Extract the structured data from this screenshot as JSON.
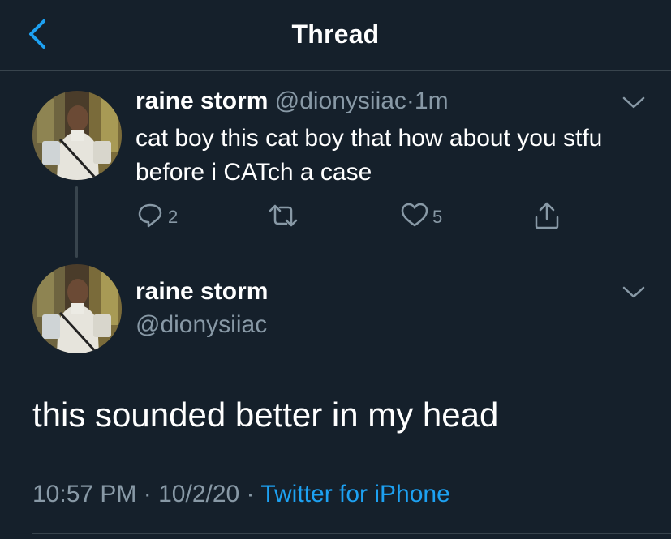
{
  "header": {
    "title": "Thread"
  },
  "parent_tweet": {
    "name": "raine storm",
    "handle": "@dionysiiac",
    "separator": "·",
    "time_ago": "1m",
    "text": "cat boy this cat boy that how about you stfu before i CATch a case",
    "actions": {
      "reply_count": "2",
      "retweet_count": "",
      "like_count": "5"
    }
  },
  "main_tweet": {
    "name": "raine storm",
    "handle": "@dionysiiac",
    "text": "this sounded better in my head",
    "time": "10:57 PM",
    "sep1": "·",
    "date": "10/2/20",
    "sep2": "·",
    "source": "Twitter for iPhone"
  },
  "colors": {
    "background": "#15202b",
    "accent": "#1da1f2",
    "secondary_text": "#8899a6",
    "divider": "#38444d"
  },
  "icons": [
    "back-chevron-icon",
    "caret-down-icon",
    "reply-icon",
    "retweet-icon",
    "like-icon",
    "share-icon"
  ]
}
